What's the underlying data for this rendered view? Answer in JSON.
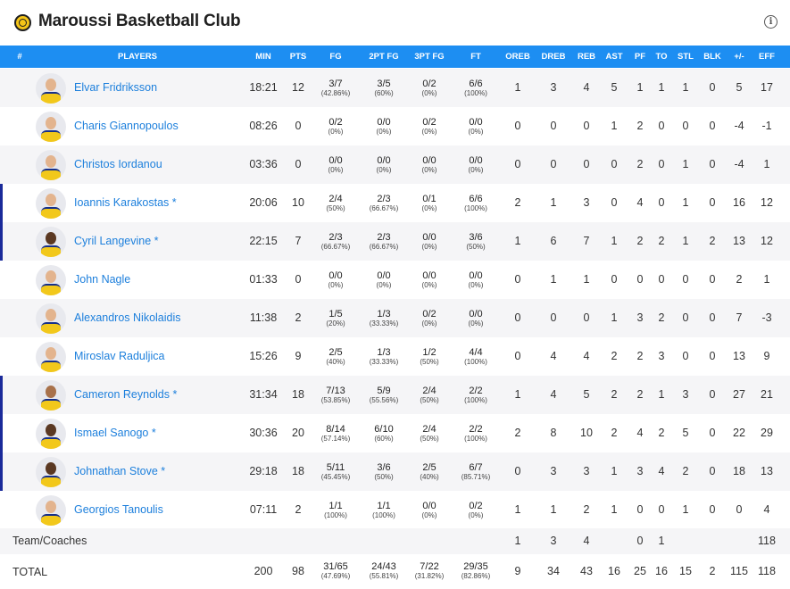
{
  "team": {
    "name": "Maroussi Basketball Club"
  },
  "icons": {
    "logo": "team-logo-icon",
    "info": "info-icon",
    "info_glyph": "i"
  },
  "colors": {
    "header_bg": "#1d8ef2",
    "player_link": "#1c7fdc",
    "starter_bar": "#1a2a9a",
    "jersey": "#f2c81b"
  },
  "columns": [
    "#",
    "PLAYERS",
    "MIN",
    "PTS",
    "FG",
    "2PT FG",
    "3PT FG",
    "FT",
    "OREB",
    "DREB",
    "REB",
    "AST",
    "PF",
    "TO",
    "STL",
    "BLK",
    "+/-",
    "EFF"
  ],
  "players": [
    {
      "name": "Elvar Fridriksson",
      "starter": false,
      "skin": "light",
      "min": "18:21",
      "pts": "12",
      "fg": "3/7",
      "fg_pct": "(42.86%)",
      "fg2": "3/5",
      "fg2_pct": "(60%)",
      "fg3": "0/2",
      "fg3_pct": "(0%)",
      "ft": "6/6",
      "ft_pct": "(100%)",
      "oreb": "1",
      "dreb": "3",
      "reb": "4",
      "ast": "5",
      "pf": "1",
      "to": "1",
      "stl": "1",
      "blk": "0",
      "pm": "5",
      "eff": "17"
    },
    {
      "name": "Charis Giannopoulos",
      "starter": false,
      "skin": "light",
      "min": "08:26",
      "pts": "0",
      "fg": "0/2",
      "fg_pct": "(0%)",
      "fg2": "0/0",
      "fg2_pct": "(0%)",
      "fg3": "0/2",
      "fg3_pct": "(0%)",
      "ft": "0/0",
      "ft_pct": "(0%)",
      "oreb": "0",
      "dreb": "0",
      "reb": "0",
      "ast": "1",
      "pf": "2",
      "to": "0",
      "stl": "0",
      "blk": "0",
      "pm": "-4",
      "eff": "-1"
    },
    {
      "name": "Christos Iordanou",
      "starter": false,
      "skin": "light",
      "min": "03:36",
      "pts": "0",
      "fg": "0/0",
      "fg_pct": "(0%)",
      "fg2": "0/0",
      "fg2_pct": "(0%)",
      "fg3": "0/0",
      "fg3_pct": "(0%)",
      "ft": "0/0",
      "ft_pct": "(0%)",
      "oreb": "0",
      "dreb": "0",
      "reb": "0",
      "ast": "0",
      "pf": "2",
      "to": "0",
      "stl": "1",
      "blk": "0",
      "pm": "-4",
      "eff": "1"
    },
    {
      "name": "Ioannis Karakostas *",
      "starter": true,
      "skin": "light",
      "min": "20:06",
      "pts": "10",
      "fg": "2/4",
      "fg_pct": "(50%)",
      "fg2": "2/3",
      "fg2_pct": "(66.67%)",
      "fg3": "0/1",
      "fg3_pct": "(0%)",
      "ft": "6/6",
      "ft_pct": "(100%)",
      "oreb": "2",
      "dreb": "1",
      "reb": "3",
      "ast": "0",
      "pf": "4",
      "to": "0",
      "stl": "1",
      "blk": "0",
      "pm": "16",
      "eff": "12"
    },
    {
      "name": "Cyril Langevine *",
      "starter": true,
      "skin": "dark",
      "min": "22:15",
      "pts": "7",
      "fg": "2/3",
      "fg_pct": "(66.67%)",
      "fg2": "2/3",
      "fg2_pct": "(66.67%)",
      "fg3": "0/0",
      "fg3_pct": "(0%)",
      "ft": "3/6",
      "ft_pct": "(50%)",
      "oreb": "1",
      "dreb": "6",
      "reb": "7",
      "ast": "1",
      "pf": "2",
      "to": "2",
      "stl": "1",
      "blk": "2",
      "pm": "13",
      "eff": "12"
    },
    {
      "name": "John Nagle",
      "starter": false,
      "skin": "light",
      "min": "01:33",
      "pts": "0",
      "fg": "0/0",
      "fg_pct": "(0%)",
      "fg2": "0/0",
      "fg2_pct": "(0%)",
      "fg3": "0/0",
      "fg3_pct": "(0%)",
      "ft": "0/0",
      "ft_pct": "(0%)",
      "oreb": "0",
      "dreb": "1",
      "reb": "1",
      "ast": "0",
      "pf": "0",
      "to": "0",
      "stl": "0",
      "blk": "0",
      "pm": "2",
      "eff": "1"
    },
    {
      "name": "Alexandros Nikolaidis",
      "starter": false,
      "skin": "light",
      "min": "11:38",
      "pts": "2",
      "fg": "1/5",
      "fg_pct": "(20%)",
      "fg2": "1/3",
      "fg2_pct": "(33.33%)",
      "fg3": "0/2",
      "fg3_pct": "(0%)",
      "ft": "0/0",
      "ft_pct": "(0%)",
      "oreb": "0",
      "dreb": "0",
      "reb": "0",
      "ast": "1",
      "pf": "3",
      "to": "2",
      "stl": "0",
      "blk": "0",
      "pm": "7",
      "eff": "-3"
    },
    {
      "name": "Miroslav Raduljica",
      "starter": false,
      "skin": "light",
      "min": "15:26",
      "pts": "9",
      "fg": "2/5",
      "fg_pct": "(40%)",
      "fg2": "1/3",
      "fg2_pct": "(33.33%)",
      "fg3": "1/2",
      "fg3_pct": "(50%)",
      "ft": "4/4",
      "ft_pct": "(100%)",
      "oreb": "0",
      "dreb": "4",
      "reb": "4",
      "ast": "2",
      "pf": "2",
      "to": "3",
      "stl": "0",
      "blk": "0",
      "pm": "13",
      "eff": "9"
    },
    {
      "name": "Cameron Reynolds *",
      "starter": true,
      "skin": "medium",
      "min": "31:34",
      "pts": "18",
      "fg": "7/13",
      "fg_pct": "(53.85%)",
      "fg2": "5/9",
      "fg2_pct": "(55.56%)",
      "fg3": "2/4",
      "fg3_pct": "(50%)",
      "ft": "2/2",
      "ft_pct": "(100%)",
      "oreb": "1",
      "dreb": "4",
      "reb": "5",
      "ast": "2",
      "pf": "2",
      "to": "1",
      "stl": "3",
      "blk": "0",
      "pm": "27",
      "eff": "21"
    },
    {
      "name": "Ismael Sanogo *",
      "starter": true,
      "skin": "dark",
      "min": "30:36",
      "pts": "20",
      "fg": "8/14",
      "fg_pct": "(57.14%)",
      "fg2": "6/10",
      "fg2_pct": "(60%)",
      "fg3": "2/4",
      "fg3_pct": "(50%)",
      "ft": "2/2",
      "ft_pct": "(100%)",
      "oreb": "2",
      "dreb": "8",
      "reb": "10",
      "ast": "2",
      "pf": "4",
      "to": "2",
      "stl": "5",
      "blk": "0",
      "pm": "22",
      "eff": "29"
    },
    {
      "name": "Johnathan Stove *",
      "starter": true,
      "skin": "dark",
      "min": "29:18",
      "pts": "18",
      "fg": "5/11",
      "fg_pct": "(45.45%)",
      "fg2": "3/6",
      "fg2_pct": "(50%)",
      "fg3": "2/5",
      "fg3_pct": "(40%)",
      "ft": "6/7",
      "ft_pct": "(85.71%)",
      "oreb": "0",
      "dreb": "3",
      "reb": "3",
      "ast": "1",
      "pf": "3",
      "to": "4",
      "stl": "2",
      "blk": "0",
      "pm": "18",
      "eff": "13"
    },
    {
      "name": "Georgios Tanoulis",
      "starter": false,
      "skin": "light",
      "min": "07:11",
      "pts": "2",
      "fg": "1/1",
      "fg_pct": "(100%)",
      "fg2": "1/1",
      "fg2_pct": "(100%)",
      "fg3": "0/0",
      "fg3_pct": "(0%)",
      "ft": "0/2",
      "ft_pct": "(0%)",
      "oreb": "1",
      "dreb": "1",
      "reb": "2",
      "ast": "1",
      "pf": "0",
      "to": "0",
      "stl": "1",
      "blk": "0",
      "pm": "0",
      "eff": "4"
    }
  ],
  "team_coaches": {
    "label": "Team/Coaches",
    "oreb": "1",
    "dreb": "3",
    "reb": "4",
    "pf": "0",
    "to": "1",
    "eff": "118"
  },
  "totals": {
    "label": "TOTAL",
    "min": "200",
    "pts": "98",
    "fg": "31/65",
    "fg_pct": "(47.69%)",
    "fg2": "24/43",
    "fg2_pct": "(55.81%)",
    "fg3": "7/22",
    "fg3_pct": "(31.82%)",
    "ft": "29/35",
    "ft_pct": "(82.86%)",
    "oreb": "9",
    "dreb": "34",
    "reb": "43",
    "ast": "16",
    "pf": "25",
    "to": "16",
    "stl": "15",
    "blk": "2",
    "pm": "115",
    "eff": "118"
  }
}
